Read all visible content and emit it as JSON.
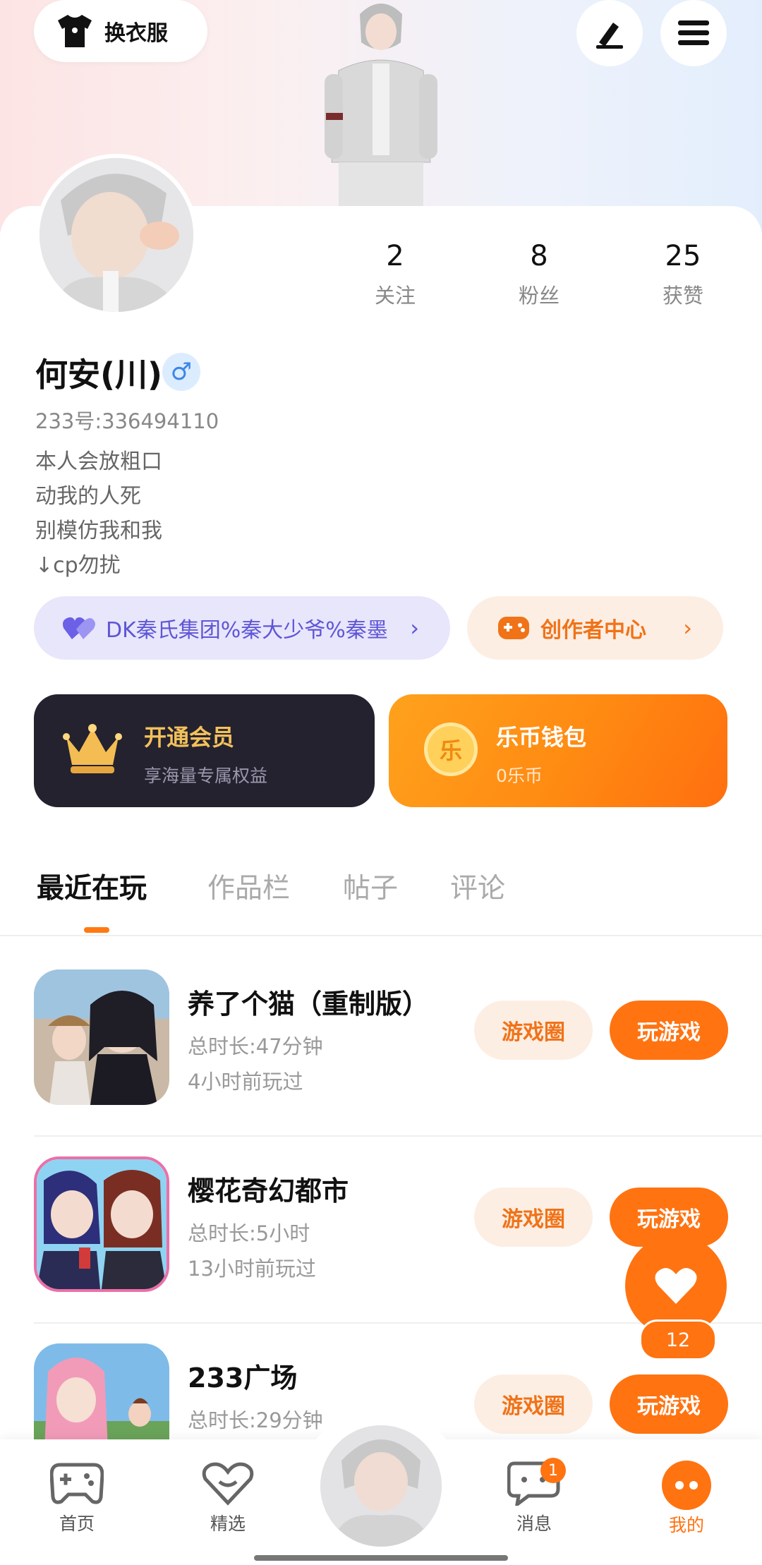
{
  "header": {
    "change_outfit_label": "换衣服"
  },
  "profile": {
    "stats": [
      {
        "value": "2",
        "label": "关注"
      },
      {
        "value": "8",
        "label": "粉丝"
      },
      {
        "value": "25",
        "label": "获赞"
      }
    ],
    "username": "何安(川)",
    "gender_symbol": "♂",
    "uid": "233号:336494110",
    "bio": [
      "本人会放粗口",
      "动我的人死",
      "别模仿我和我",
      "↓cp勿扰"
    ]
  },
  "pills": {
    "family": "DK秦氏集团%秦大少爷%秦墨",
    "creator": "创作者中心"
  },
  "cards": {
    "vip": {
      "title": "开通会员",
      "subtitle": "享海量专属权益"
    },
    "wallet": {
      "title": "乐币钱包",
      "subtitle": "0乐币",
      "coin_glyph": "乐"
    }
  },
  "tabs": [
    "最近在玩",
    "作品栏",
    "帖子",
    "评论"
  ],
  "games": [
    {
      "title": "养了个猫（重制版）",
      "duration": "总时长:47分钟",
      "last_played": "4小时前玩过",
      "circle_label": "游戏圈",
      "play_label": "玩游戏"
    },
    {
      "title": "樱花奇幻都市",
      "duration": "总时长:5小时",
      "last_played": "13小时前玩过",
      "circle_label": "游戏圈",
      "play_label": "玩游戏"
    },
    {
      "title": "233广场",
      "duration": "总时长:29分钟",
      "last_played": "",
      "circle_label": "游戏圈",
      "play_label": "玩游戏"
    }
  ],
  "like_fab": {
    "count": "12"
  },
  "bottom_nav": {
    "items": [
      {
        "label": "首页"
      },
      {
        "label": "精选"
      },
      {
        "label": "消息",
        "badge": "1"
      },
      {
        "label": "我的"
      }
    ]
  },
  "colors": {
    "accent": "#ff7311",
    "vip_bg": "#24222f",
    "family_text": "#5f56d6"
  }
}
